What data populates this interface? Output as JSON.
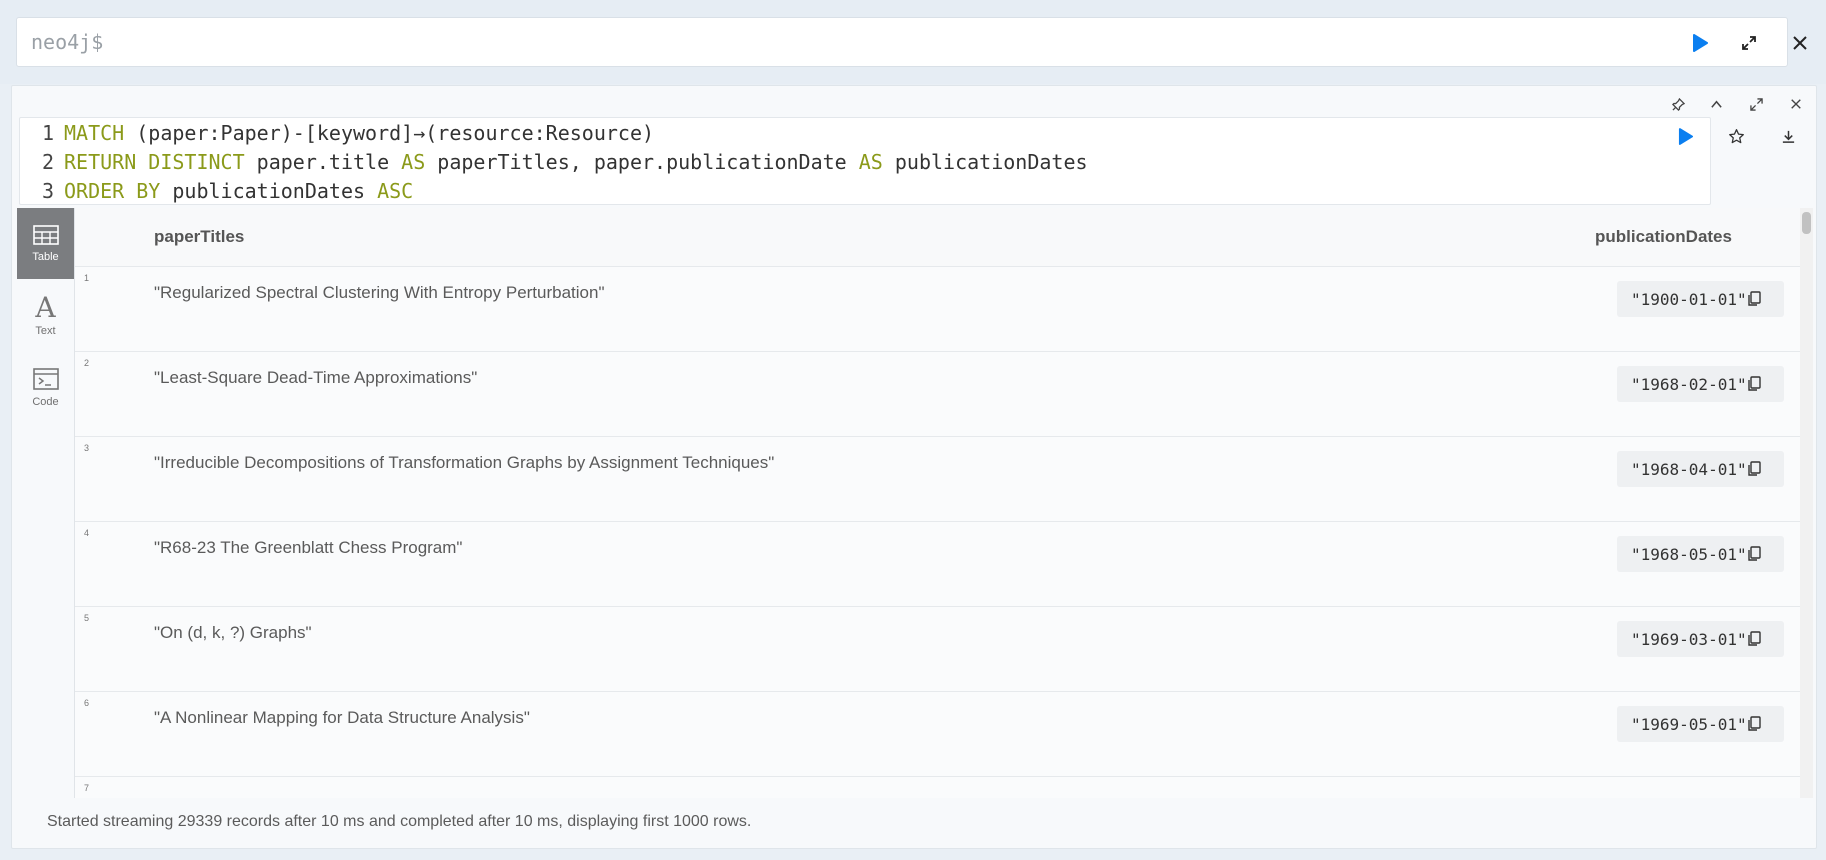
{
  "editor": {
    "prompt": "neo4j$"
  },
  "query": {
    "lines": [
      {
        "num": "1",
        "parts": [
          [
            "kw",
            "MATCH"
          ],
          [
            "tx",
            " (paper:Paper)-[keyword]→(resource:Resource)"
          ]
        ]
      },
      {
        "num": "2",
        "parts": [
          [
            "kw",
            "RETURN DISTINCT"
          ],
          [
            "tx",
            " paper.title "
          ],
          [
            "kw",
            "AS"
          ],
          [
            "tx",
            " paperTitles, paper.publicationDate "
          ],
          [
            "kw",
            "AS"
          ],
          [
            "tx",
            " publicationDates"
          ]
        ]
      },
      {
        "num": "3",
        "parts": [
          [
            "kw",
            "ORDER BY"
          ],
          [
            "tx",
            " publicationDates "
          ],
          [
            "kw",
            "ASC"
          ]
        ]
      }
    ]
  },
  "sidebar": {
    "tabs": [
      {
        "label": "Table",
        "icon": "table-icon"
      },
      {
        "label": "Text",
        "icon": "text-icon"
      },
      {
        "label": "Code",
        "icon": "code-icon"
      }
    ]
  },
  "table": {
    "columns": [
      "paperTitles",
      "publicationDates"
    ],
    "rows": [
      {
        "index": "1",
        "title": "\"Regularized Spectral Clustering With Entropy Perturbation\"",
        "date": "\"1900-01-01\""
      },
      {
        "index": "2",
        "title": "\"Least-Square Dead-Time Approximations\"",
        "date": "\"1968-02-01\""
      },
      {
        "index": "3",
        "title": "\"Irreducible Decompositions of Transformation Graphs by Assignment Techniques\"",
        "date": "\"1968-04-01\""
      },
      {
        "index": "4",
        "title": "\"R68-23 The Greenblatt Chess Program\"",
        "date": "\"1968-05-01\""
      },
      {
        "index": "5",
        "title": "\"On (d, k, ?) Graphs\"",
        "date": "\"1969-03-01\""
      },
      {
        "index": "6",
        "title": "\"A Nonlinear Mapping for Data Structure Analysis\"",
        "date": "\"1969-05-01\""
      },
      {
        "index": "7",
        "title": "",
        "date": ""
      }
    ]
  },
  "status": {
    "text": "Started streaming 29339 records after 10 ms and completed after 10 ms, displaying first 1000 rows."
  },
  "colors": {
    "accent": "#0b7ff0",
    "keyword": "#8b9a1a"
  }
}
